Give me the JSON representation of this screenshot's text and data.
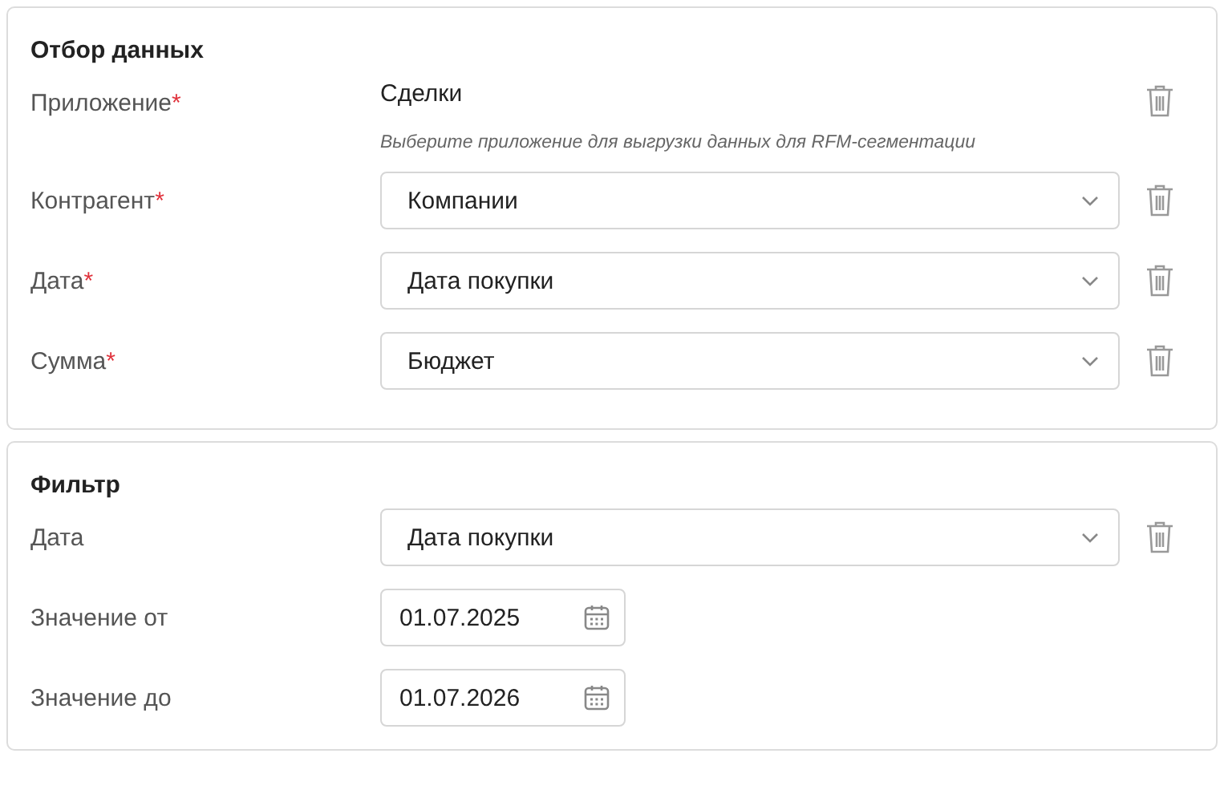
{
  "sections": [
    {
      "title": "Отбор данных",
      "rows": [
        {
          "kind": "static",
          "label": "Приложение",
          "required_mark": "*",
          "value": "Сделки",
          "hint": "Выберите приложение для выгрузки данных для RFM-сегментации",
          "deletable": true
        },
        {
          "kind": "select",
          "label": "Контрагент",
          "required_mark": "*",
          "value": "Компании",
          "deletable": true
        },
        {
          "kind": "select",
          "label": "Дата",
          "required_mark": "*",
          "value": "Дата покупки",
          "deletable": true
        },
        {
          "kind": "select",
          "label": "Сумма",
          "required_mark": "*",
          "value": "Бюджет",
          "deletable": true
        }
      ]
    },
    {
      "title": "Фильтр",
      "rows": [
        {
          "kind": "select",
          "label": "Дата",
          "value": "Дата покупки",
          "deletable": true
        },
        {
          "kind": "date",
          "label": "Значение от",
          "value": "01.07.2025",
          "deletable": false
        },
        {
          "kind": "date",
          "label": "Значение до",
          "value": "01.07.2026",
          "deletable": false
        }
      ]
    }
  ]
}
